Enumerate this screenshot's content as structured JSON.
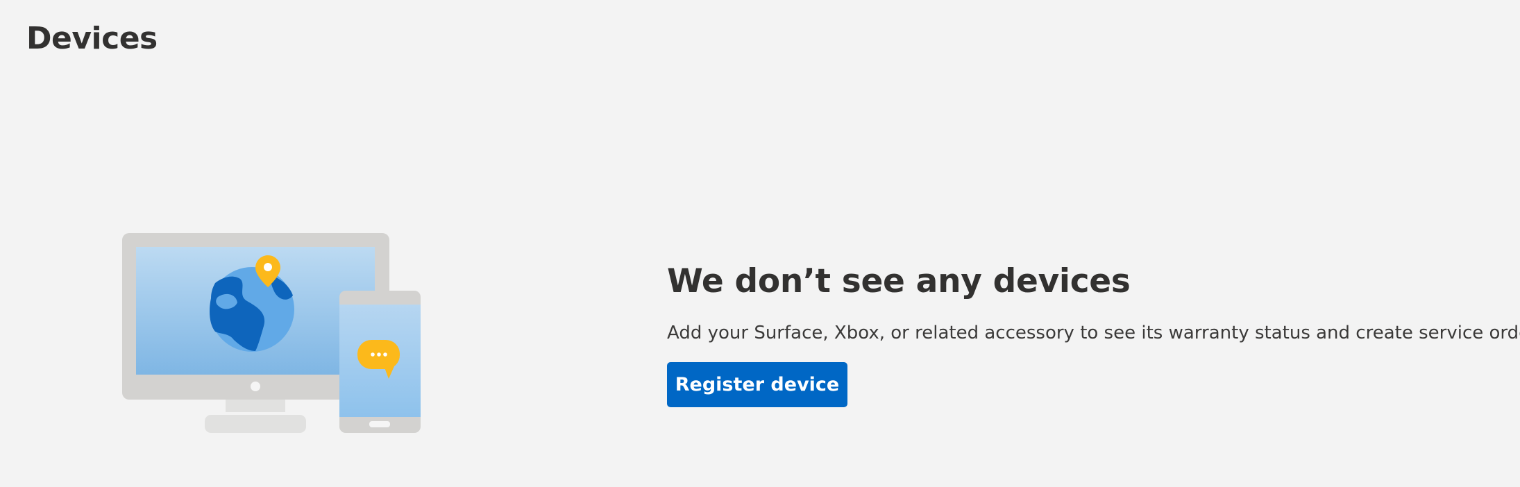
{
  "page": {
    "title": "Devices"
  },
  "empty_state": {
    "title": "We don’t see any devices",
    "description": "Add your Surface, Xbox, or related accessory to see its warranty status and create service orders.",
    "register_button_label": "Register device"
  },
  "colors": {
    "background": "#f3f3f3",
    "primary_button": "#0067c5",
    "text": "#323130"
  },
  "illustration": {
    "icon": "devices-illustration"
  }
}
